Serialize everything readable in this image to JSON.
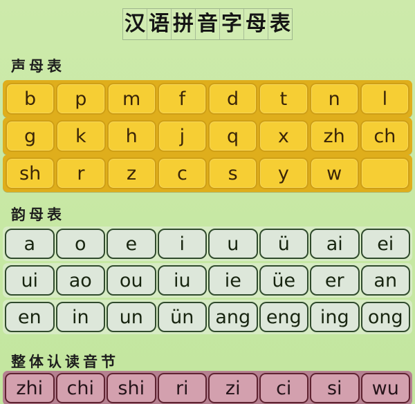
{
  "title": {
    "text": "汉语拼音字母表",
    "characters": [
      "汉",
      "语",
      "拼",
      "音",
      "字",
      "母",
      "表"
    ]
  },
  "colors": {
    "background": "#c9e9a6",
    "amber_cell": "#f6ce34",
    "amber_strip": "#dfae1c",
    "amber_border": "#cf9f15",
    "mint_cell": "#dde7da",
    "mint_strip": "#d7ebc4",
    "mint_border": "#2f4a2c",
    "rose_cell": "#d3a0ae",
    "rose_strip": "#b58090",
    "rose_border": "#5e2230",
    "text_dark": "#1d1d1d"
  },
  "sections": {
    "initials": {
      "heading": "声母表",
      "rows": [
        [
          "b",
          "p",
          "m",
          "f",
          "d",
          "t",
          "n",
          "l"
        ],
        [
          "g",
          "k",
          "h",
          "j",
          "q",
          "x",
          "zh",
          "ch"
        ],
        [
          "sh",
          "r",
          "z",
          "c",
          "s",
          "y",
          "w",
          ""
        ]
      ]
    },
    "finals": {
      "heading": "韵母表",
      "rows": [
        [
          "a",
          "o",
          "e",
          "i",
          "u",
          "ü",
          "ai",
          "ei"
        ],
        [
          "ui",
          "ao",
          "ou",
          "iu",
          "ie",
          "üe",
          "er",
          "an"
        ],
        [
          "en",
          "in",
          "un",
          "ün",
          "ang",
          "eng",
          "ing",
          "ong"
        ]
      ]
    },
    "whole_syllables": {
      "heading": "整体认读音节",
      "rows": [
        [
          "zhi",
          "chi",
          "shi",
          "ri",
          "zi",
          "ci",
          "si",
          "wu"
        ]
      ]
    }
  }
}
